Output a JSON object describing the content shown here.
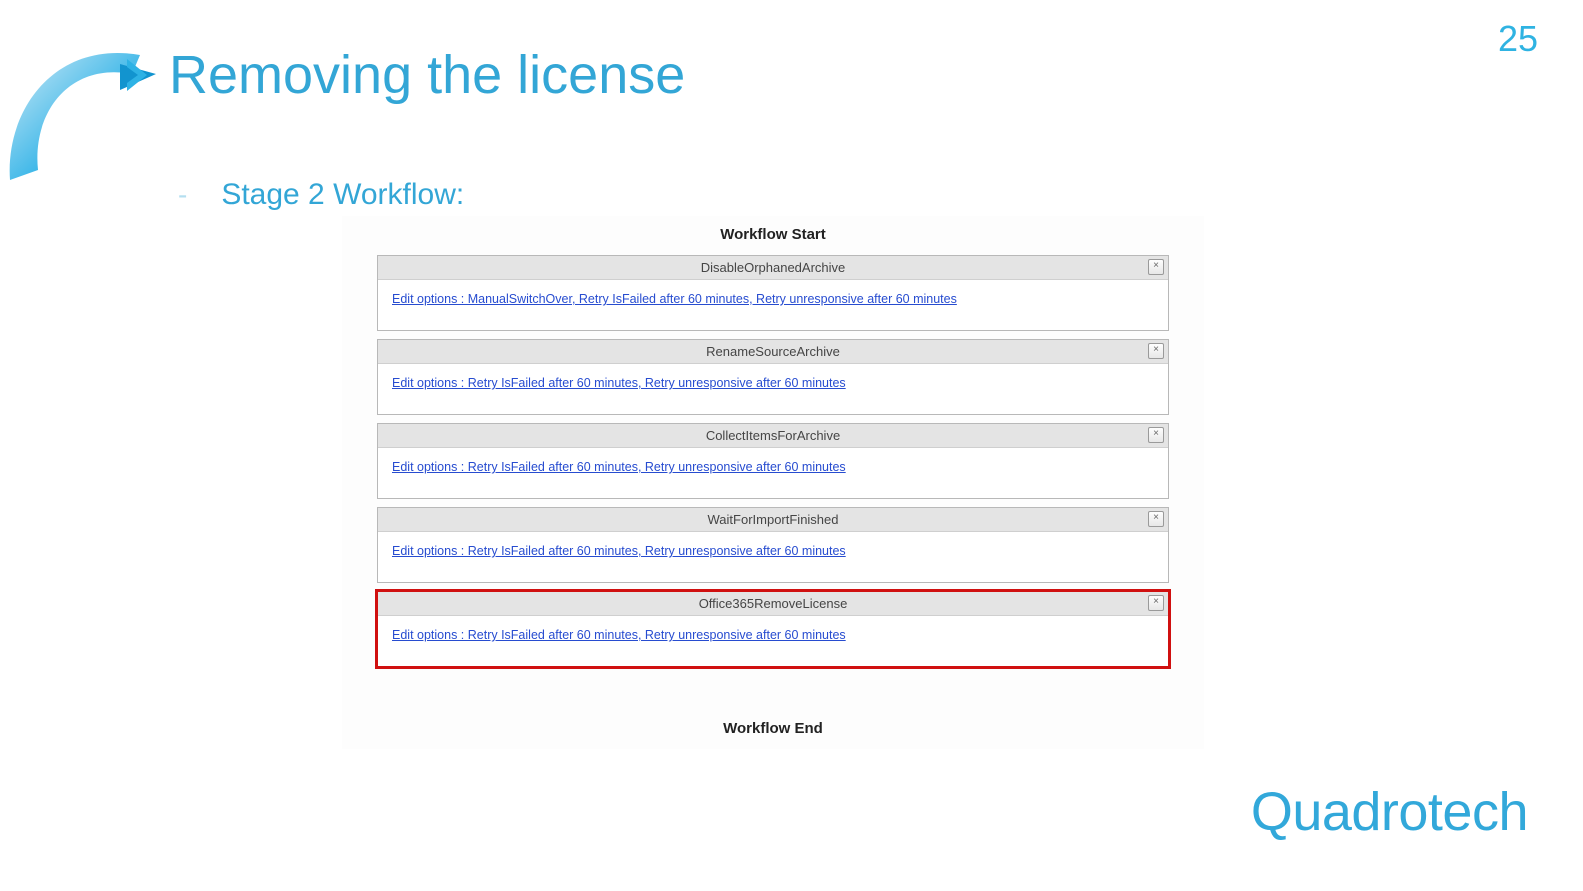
{
  "page_number": "25",
  "title": "Removing the license",
  "bullet_dash": "-",
  "bullet_text": "Stage 2 Workflow:",
  "workflow": {
    "start_label": "Workflow Start",
    "end_label": "Workflow End",
    "close_glyph": "×",
    "steps": [
      {
        "name": "DisableOrphanedArchive",
        "options": "Edit options : ManualSwitchOver, Retry IsFailed after 60 minutes, Retry unresponsive after 60 minutes",
        "highlight": false
      },
      {
        "name": "RenameSourceArchive",
        "options": "Edit options : Retry IsFailed after 60 minutes, Retry unresponsive after 60 minutes",
        "highlight": false
      },
      {
        "name": "CollectItemsForArchive",
        "options": "Edit options : Retry IsFailed after 60 minutes, Retry unresponsive after 60 minutes",
        "highlight": false
      },
      {
        "name": "WaitForImportFinished",
        "options": "Edit options : Retry IsFailed after 60 minutes, Retry unresponsive after 60 minutes",
        "highlight": false
      },
      {
        "name": "Office365RemoveLicense",
        "options": "Edit options : Retry IsFailed after 60 minutes, Retry unresponsive after 60 minutes",
        "highlight": true
      }
    ]
  },
  "brand": "Quadrotech"
}
